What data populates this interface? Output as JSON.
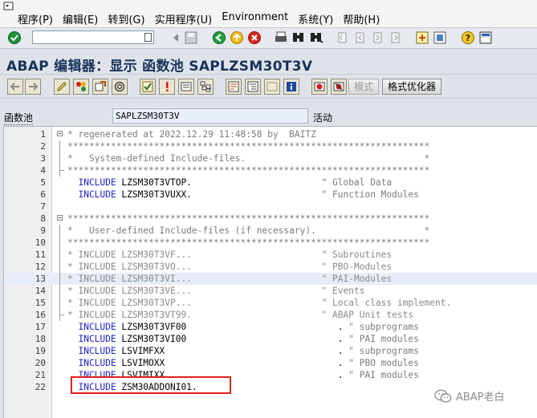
{
  "menu": {
    "items": [
      "程序(P)",
      "编辑(E)",
      "转到(G)",
      "实用程序(U)",
      "Environment",
      "系统(Y)",
      "帮助(H)"
    ]
  },
  "toolbar": {
    "command_value": "",
    "icons": [
      "enter-icon",
      "save-icon",
      "back-icon",
      "exit-icon",
      "cancel-icon",
      "print-icon",
      "find-icon",
      "find-next-icon",
      "first-page-icon",
      "prev-page-icon",
      "next-page-icon",
      "last-page-icon",
      "new-session-icon",
      "shortcut-icon",
      "help-icon",
      "customize-layout-icon"
    ]
  },
  "title": "ABAP 编辑器：显示 函数池 SAPLZSM30T3V",
  "app_toolbar": {
    "mode_label": "模式",
    "pretty_printer_label": "格式优化器"
  },
  "function_pool": {
    "label": "函数池",
    "value": "SAPLZSM30T3V",
    "status": "活动"
  },
  "code_lines": [
    {
      "n": "1",
      "t": "* regenerated at 2022.12.29 11:48:58 by  BAITZ"
    },
    {
      "n": "2",
      "t": "*******************************************************************"
    },
    {
      "n": "3",
      "t": "*   System-defined Include-files.                                 *"
    },
    {
      "n": "4",
      "t": "*******************************************************************"
    },
    {
      "n": "5",
      "kw": "  INCLUDE",
      "t": " LZSM30T3VTOP.                        \" Global Data"
    },
    {
      "n": "6",
      "kw": "  INCLUDE",
      "t": " LZSM30T3VUXX.                        \" Function Modules"
    },
    {
      "n": "7",
      "t": ""
    },
    {
      "n": "8",
      "t": "*******************************************************************"
    },
    {
      "n": "9",
      "t": "*   User-defined Include-files (if necessary).                    *"
    },
    {
      "n": "10",
      "t": "*******************************************************************"
    },
    {
      "n": "11",
      "t": "* INCLUDE LZSM30T3VF...                        \" Subroutines"
    },
    {
      "n": "12",
      "t": "* INCLUDE LZSM30T3VO...                        \" PBO-Modules"
    },
    {
      "n": "13",
      "t": "* INCLUDE LZSM30T3VI...                        \" PAI-Modules"
    },
    {
      "n": "14",
      "t": "* INCLUDE LZSM30T3VE...                        \" Events"
    },
    {
      "n": "15",
      "t": "* INCLUDE LZSM30T3VP...                        \" Local class implement."
    },
    {
      "n": "16",
      "t": "* INCLUDE LZSM30T3VT99.                        \" ABAP Unit tests"
    },
    {
      "n": "17",
      "kw": "  INCLUDE",
      "t": " LZSM30T3VF00                            . \" subprograms"
    },
    {
      "n": "18",
      "kw": "  INCLUDE",
      "t": " LZSM30T3VI00                            . \" PAI modules"
    },
    {
      "n": "19",
      "kw": "  INCLUDE",
      "t": " LSVIMFXX                                . \" subprograms"
    },
    {
      "n": "20",
      "kw": "  INCLUDE",
      "t": " LSVIMOXX                                . \" PBO modules"
    },
    {
      "n": "21",
      "kw": "  INCLUDE",
      "t": " LSVIMIXX                                . \" PAI modules"
    },
    {
      "n": "22",
      "kw": "  INCLUDE",
      "t": " ZSM30ADDONI01."
    }
  ],
  "watermark": "ABAP老白"
}
